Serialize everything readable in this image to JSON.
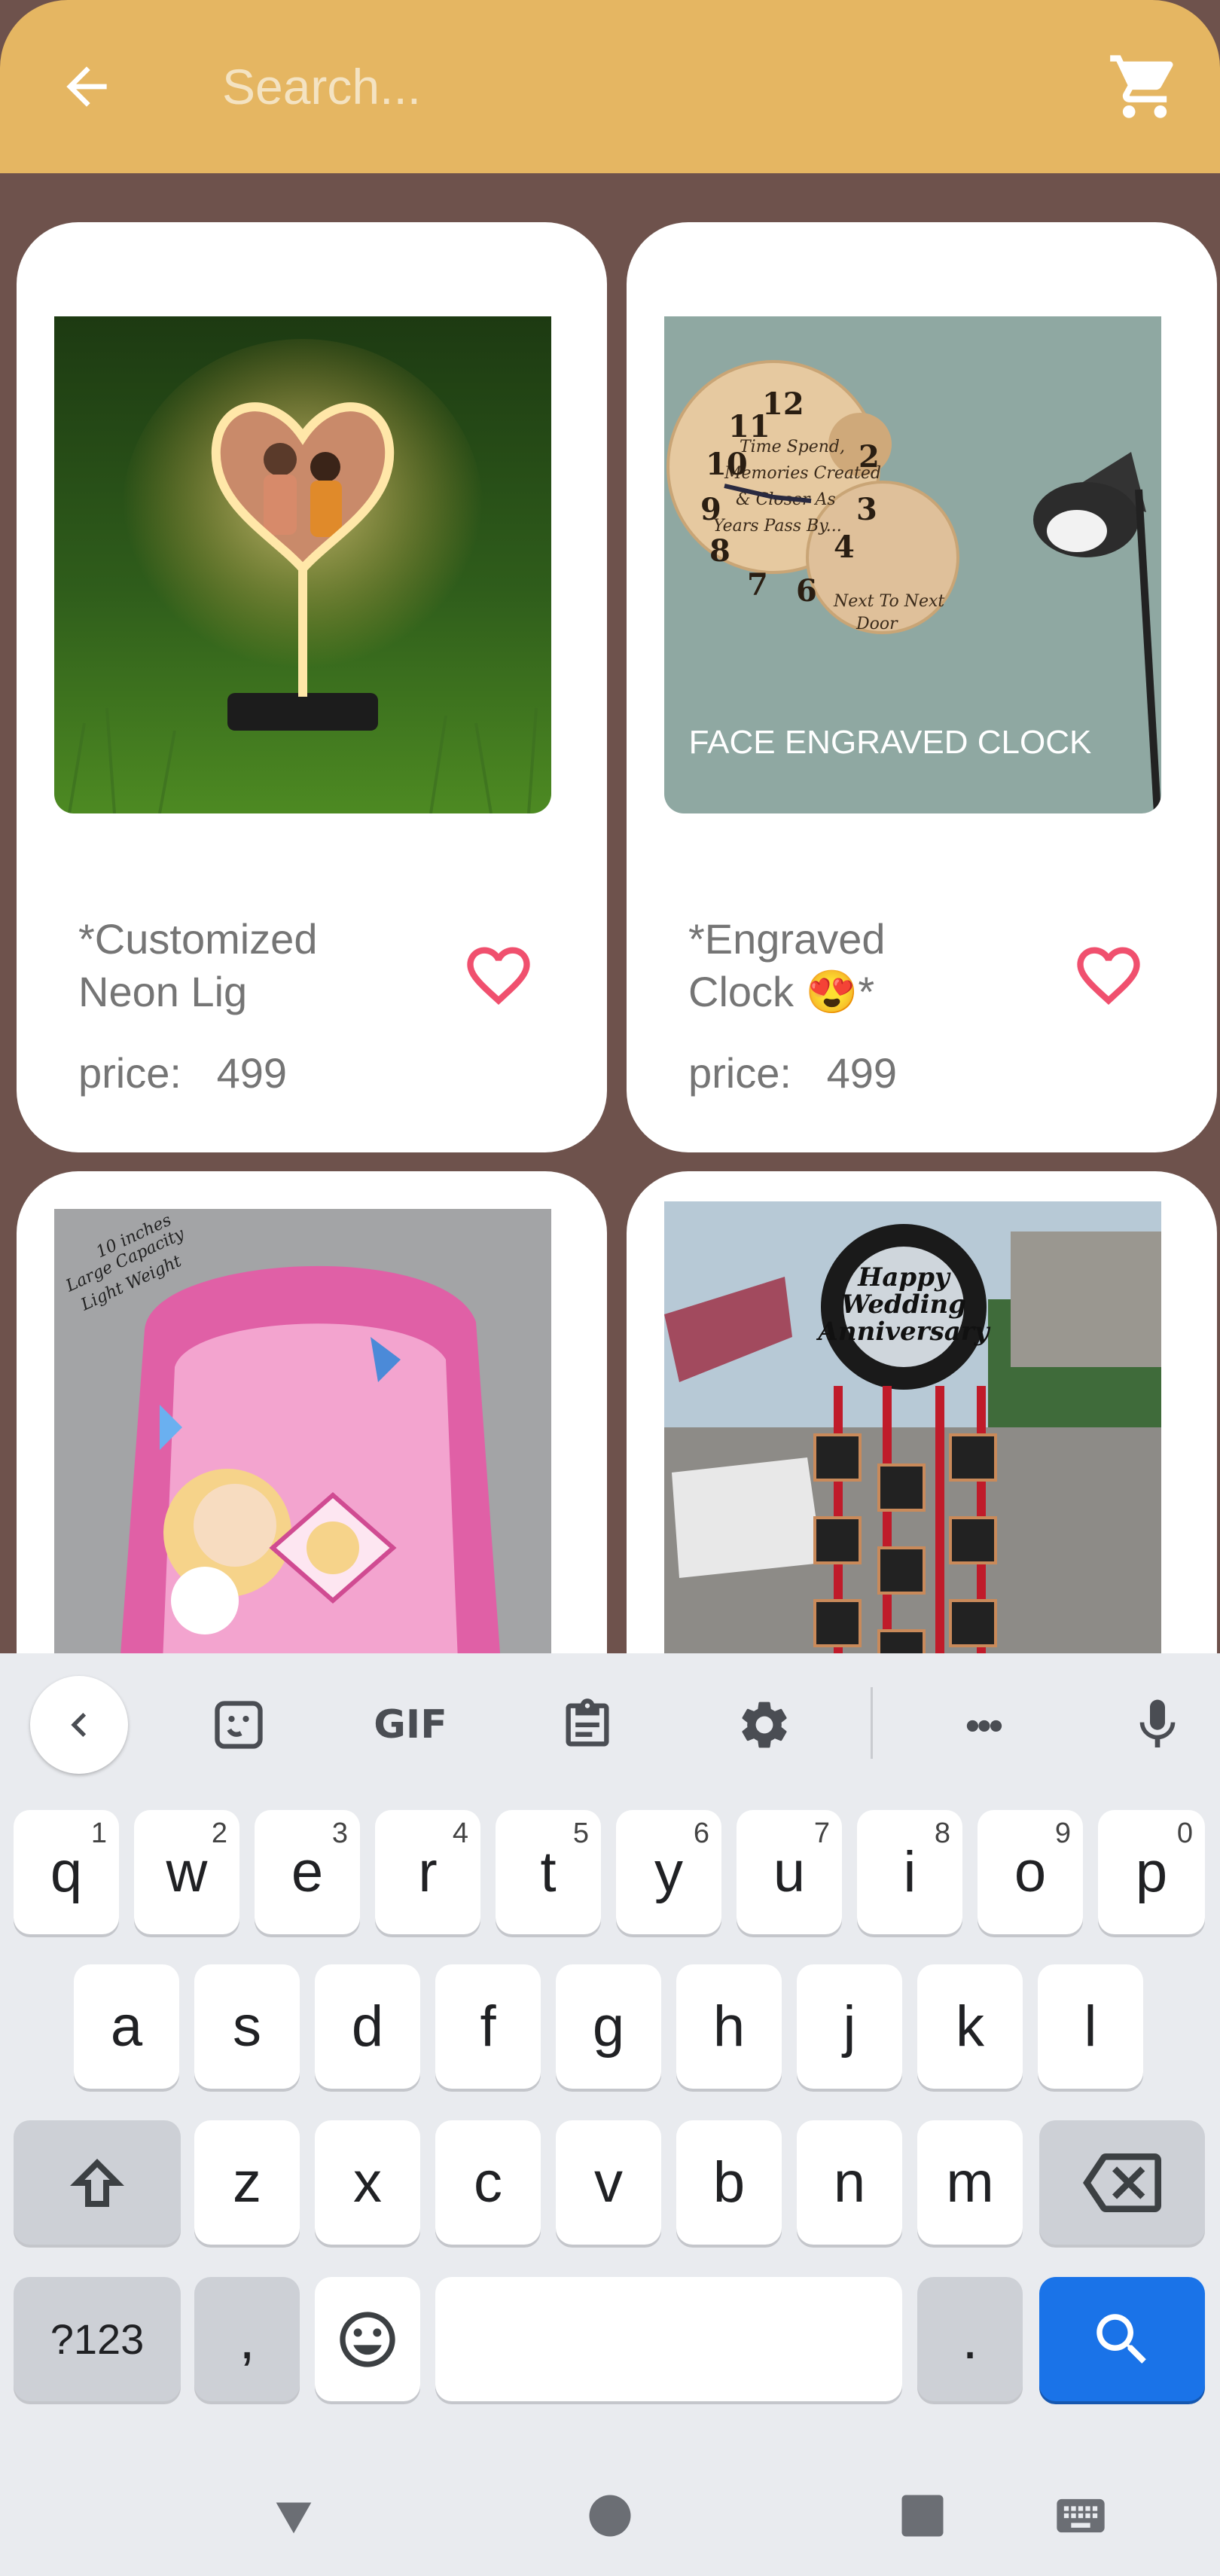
{
  "search": {
    "placeholder": "Search..."
  },
  "products": [
    {
      "title": "*Customized Neon Lig",
      "price_label": "price:",
      "price": "499"
    },
    {
      "title": "*Engraved Clock 😍*",
      "price_label": "price:",
      "price": "499"
    },
    {
      "title": "",
      "price_label": "",
      "price": ""
    },
    {
      "title": "",
      "price_label": "",
      "price": ""
    }
  ],
  "product_image_text": {
    "clock_caption": "FACE ENGRAVED CLOCK",
    "clock_face_text": [
      "Time Spend,",
      "Memories Created",
      "& Closer As",
      "Years Pass By..."
    ],
    "clock_second_text": [
      "Next To Next",
      "Door"
    ],
    "bag_text": [
      "10 inches",
      "Large Capacity",
      "Light Weight"
    ],
    "anniversary_text": [
      "Happy",
      "Wedding",
      "Anniversary"
    ]
  },
  "keyboard": {
    "toolbar": {
      "gif_label": "GIF",
      "more_label": "•••"
    },
    "row1": [
      {
        "key": "q",
        "hint": "1"
      },
      {
        "key": "w",
        "hint": "2"
      },
      {
        "key": "e",
        "hint": "3"
      },
      {
        "key": "r",
        "hint": "4"
      },
      {
        "key": "t",
        "hint": "5"
      },
      {
        "key": "y",
        "hint": "6"
      },
      {
        "key": "u",
        "hint": "7"
      },
      {
        "key": "i",
        "hint": "8"
      },
      {
        "key": "o",
        "hint": "9"
      },
      {
        "key": "p",
        "hint": "0"
      }
    ],
    "row2": [
      "a",
      "s",
      "d",
      "f",
      "g",
      "h",
      "j",
      "k",
      "l"
    ],
    "row3": [
      "z",
      "x",
      "c",
      "v",
      "b",
      "n",
      "m"
    ],
    "symbols_label": "?123",
    "comma_label": ",",
    "period_label": "."
  },
  "colors": {
    "topbar": "#e5b662",
    "background": "#6e524c",
    "heart": "#f0506e",
    "keyboard_action": "#1a73e8"
  },
  "icons": {
    "back": "arrow-left-icon",
    "cart": "shopping-cart-icon",
    "favorite": "heart-outline-icon",
    "search_key": "search-icon",
    "shift": "shift-icon",
    "backspace": "backspace-icon",
    "emoji": "emoji-icon",
    "mic": "microphone-icon",
    "settings": "gear-icon",
    "clipboard": "clipboard-icon",
    "sticker": "sticker-icon"
  }
}
